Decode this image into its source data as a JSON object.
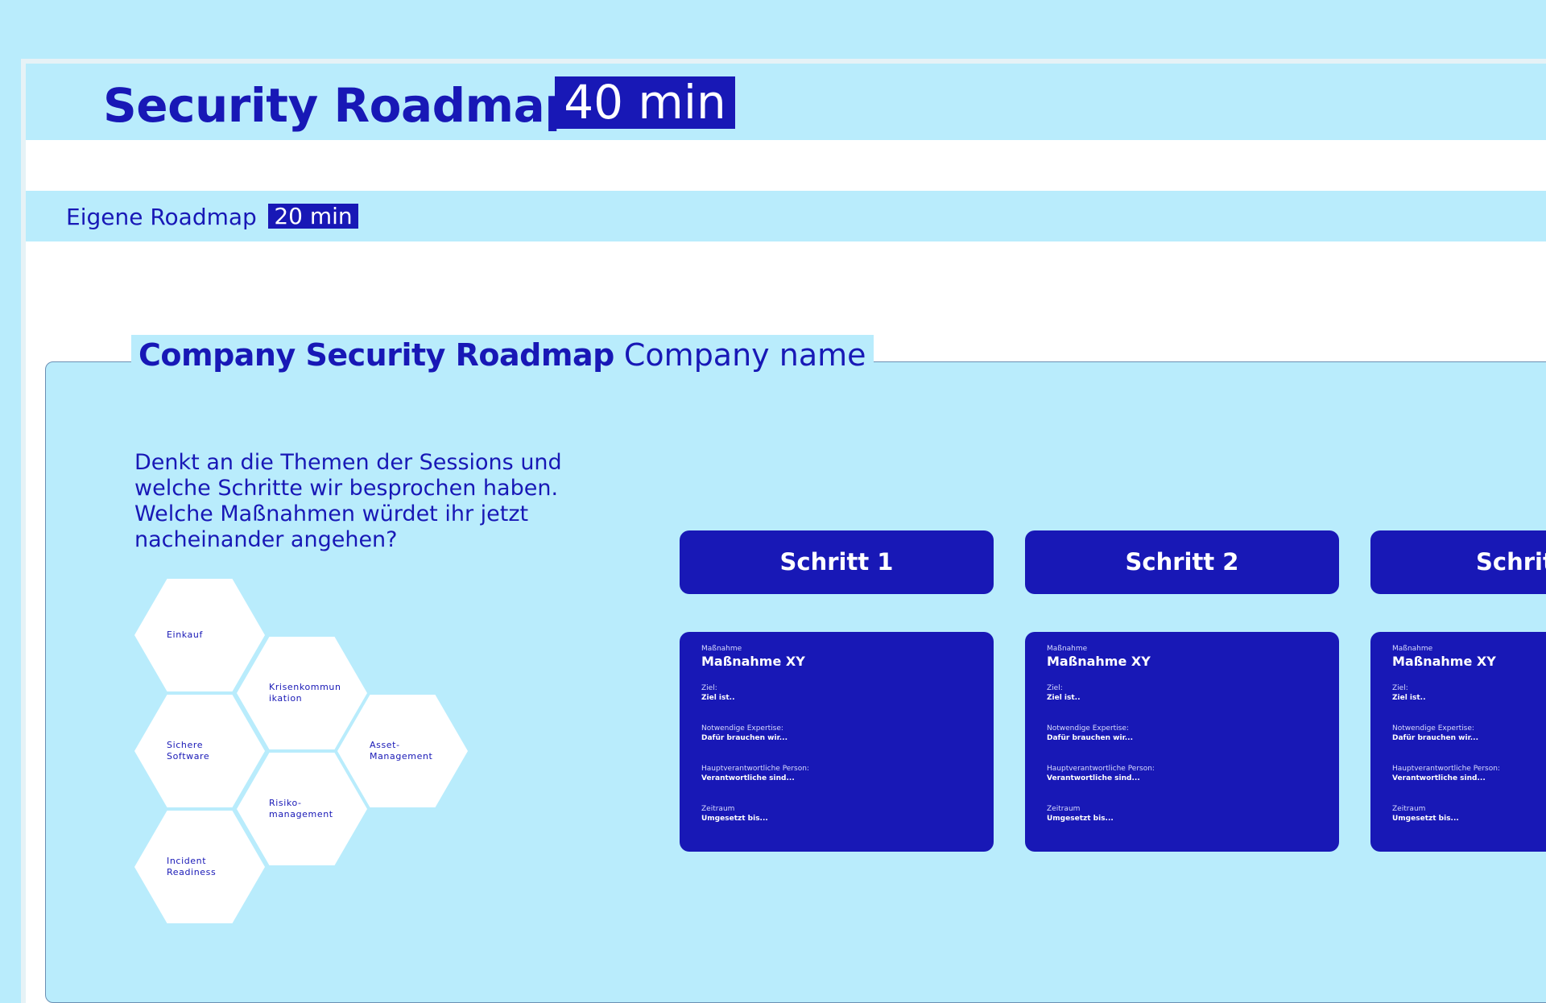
{
  "header": {
    "title": "Security Roadmap",
    "time": "40 min"
  },
  "section": {
    "title": "Eigene Roadmap",
    "time": "20 min"
  },
  "board": {
    "label_strong": "Company Security Roadmap",
    "label_name": "Company name",
    "question_lines": [
      "Denkt an die Themen der Sessions und",
      "welche Schritte wir besprochen haben.",
      "Welche Maßnahmen würdet ihr jetzt",
      "nacheinander angehen?"
    ]
  },
  "topics": [
    "Einkauf",
    "Krisenkommun\nikation",
    "Sichere\nSoftware",
    "Asset-\nManagement",
    "Risiko-\nmanagement",
    "Incident\nReadiness"
  ],
  "steps": [
    {
      "header": "Schritt 1",
      "card": {
        "kicker": "Maßnahme",
        "title": "Maßnahme XY",
        "fields": [
          {
            "label": "Ziel:",
            "value": "Ziel ist.."
          },
          {
            "label": "Notwendige Expertise:",
            "value": "Dafür brauchen wir..."
          },
          {
            "label": "Hauptverantwortliche Person:",
            "value": "Verantwortliche sind..."
          },
          {
            "label": "Zeitraum",
            "value": "Umgesetzt bis..."
          }
        ]
      }
    },
    {
      "header": "Schritt 2",
      "card": {
        "kicker": "Maßnahme",
        "title": "Maßnahme XY",
        "fields": [
          {
            "label": "Ziel:",
            "value": "Ziel ist.."
          },
          {
            "label": "Notwendige Expertise:",
            "value": "Dafür brauchen wir..."
          },
          {
            "label": "Hauptverantwortliche Person:",
            "value": "Verantwortliche sind..."
          },
          {
            "label": "Zeitraum",
            "value": "Umgesetzt bis..."
          }
        ]
      }
    },
    {
      "header": "Schritt",
      "card": {
        "kicker": "Maßnahme",
        "title": "Maßnahme XY",
        "fields": [
          {
            "label": "Ziel:",
            "value": "Ziel ist.."
          },
          {
            "label": "Notwendige Expertise:",
            "value": "Dafür brauchen wir..."
          },
          {
            "label": "Hauptverantwortliche Person:",
            "value": "Verantwortliche sind..."
          },
          {
            "label": "Zeitraum",
            "value": "Umgesetzt bis..."
          }
        ]
      }
    }
  ],
  "colors": {
    "background": "#b9ecfc",
    "accent": "#1818b6",
    "panel": "#ffffff"
  }
}
